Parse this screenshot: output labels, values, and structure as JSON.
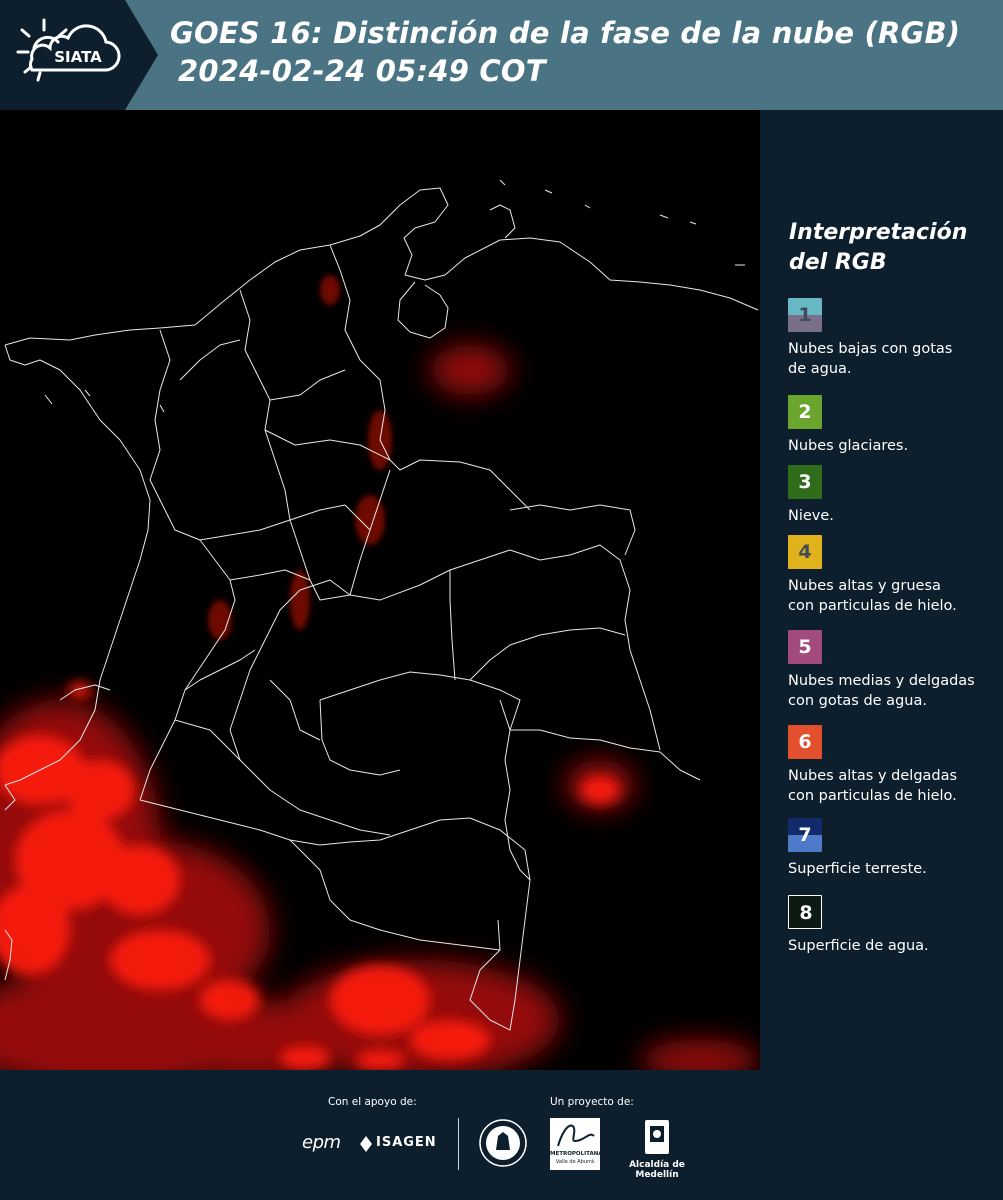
{
  "header": {
    "logo_text": "SIATA",
    "title_line1": "GOES 16: Distinción de la fase de la nube (RGB)",
    "title_line2": "2024-02-24 05:49 COT"
  },
  "legend": {
    "title_line1": "Interpretación",
    "title_line2": "del RGB",
    "items": [
      {
        "num": "1",
        "label_line1": "Nubes bajas con gotas",
        "label_line2": "de agua.",
        "color_top": "#67b7c4",
        "color_bottom": "#7a6f8a",
        "num_color": "#3f4b58"
      },
      {
        "num": "2",
        "label_line1": "Nubes glaciares.",
        "label_line2": "",
        "color_top": "#6aa52e",
        "color_bottom": "#6aa52e",
        "num_color": "#ffffff"
      },
      {
        "num": "3",
        "label_line1": "Nieve.",
        "label_line2": "",
        "color_top": "#2f6d1d",
        "color_bottom": "#2f6d1d",
        "num_color": "#ffffff"
      },
      {
        "num": "4",
        "label_line1": "Nubes altas y gruesa",
        "label_line2": "con particulas de hielo.",
        "color_top": "#e2b21c",
        "color_bottom": "#e2b21c",
        "num_color": "#3f4b58"
      },
      {
        "num": "5",
        "label_line1": "Nubes medias y delgadas",
        "label_line2": "con gotas de agua.",
        "color_top": "#a34b7c",
        "color_bottom": "#a34b7c",
        "num_color": "#ffffff"
      },
      {
        "num": "6",
        "label_line1": "Nubes altas y delgadas",
        "label_line2": "con particulas de hielo.",
        "color_top": "#e2502e",
        "color_bottom": "#e2502e",
        "num_color": "#ffffff"
      },
      {
        "num": "7",
        "label_line1": "Superficie terreste.",
        "label_line2": "",
        "color_top": "#132b6b",
        "color_bottom": "#4f7ac9",
        "num_color": "#ffffff"
      },
      {
        "num": "8",
        "label_line1": "Superficie de agua.",
        "label_line2": "",
        "color_top": "#0b1a12",
        "color_bottom": "#0b1a12",
        "num_color": "#ffffff"
      }
    ]
  },
  "footer": {
    "support_caption": "Con el apoyo de:",
    "project_caption": "Un proyecto de:",
    "logos": {
      "epm": "epm",
      "isagen": "ISAGEN",
      "metropolitana": "METROPOLITANA",
      "metropolitana_sub": "Valle de Aburrá",
      "alcaldia": "Alcaldía de Medellín"
    }
  },
  "colors": {
    "header_bg": "#4a7484",
    "panel_bg": "#0d1f2d",
    "cloud_red": "#ff1a10"
  }
}
